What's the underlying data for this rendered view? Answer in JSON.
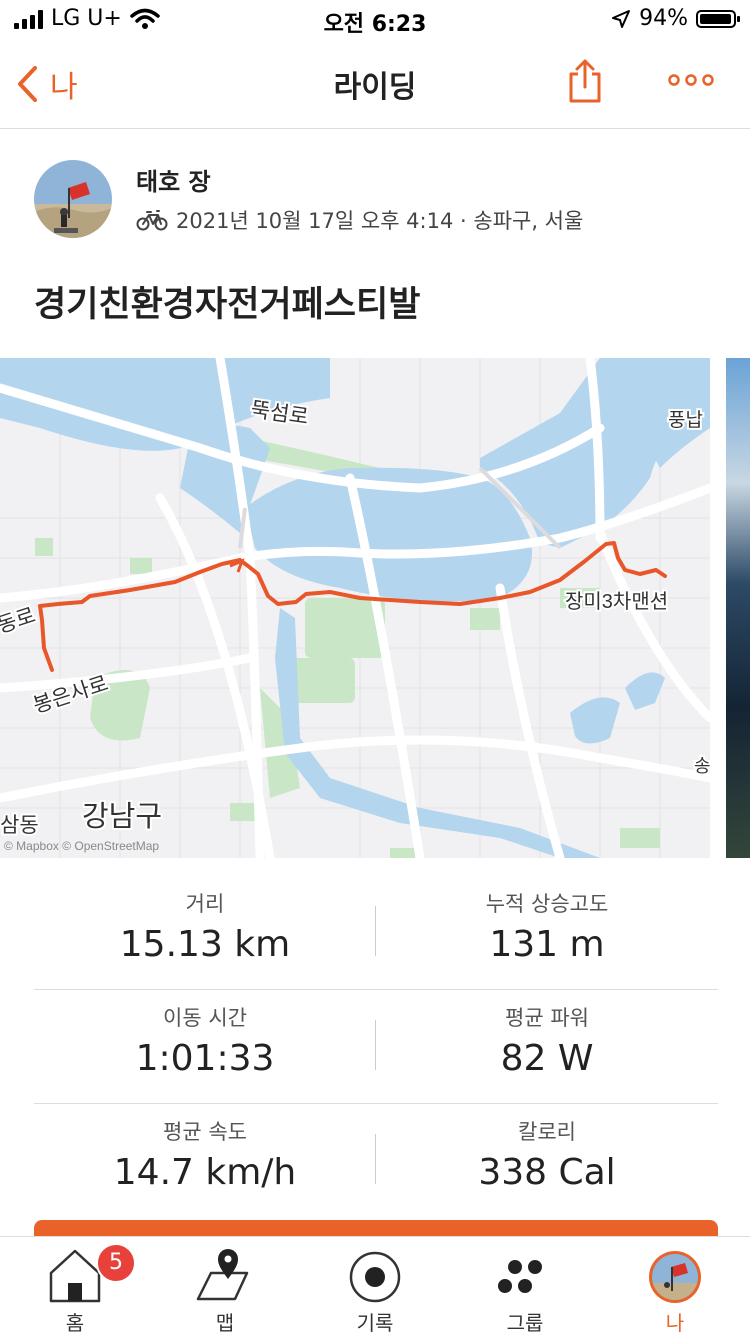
{
  "status_bar": {
    "carrier": "LG U+",
    "time": "오전 6:23",
    "battery": "94%"
  },
  "nav": {
    "back_label": "나",
    "title": "라이딩"
  },
  "activity": {
    "athlete": "태호 장",
    "meta": "2021년 10월 17일 오후 4:14 · 송파구, 서울",
    "title": "경기친환경자전거페스티발"
  },
  "map": {
    "labels": {
      "ttukseom": "뚝섬로",
      "pungnap": "풍납",
      "jangmi": "장미3차맨션",
      "dongro": "동로",
      "bongeun": "봉은사로",
      "gangnam": "강남구",
      "samdong": "삼동",
      "song": "송",
      "attribution": "© Mapbox © OpenStreetMap"
    }
  },
  "stats": [
    {
      "left": {
        "label": "거리",
        "value": "15.13 km"
      },
      "right": {
        "label": "누적 상승고도",
        "value": "131 m"
      }
    },
    {
      "left": {
        "label": "이동 시간",
        "value": "1:01:33"
      },
      "right": {
        "label": "평균 파워",
        "value": "82 W"
      }
    },
    {
      "left": {
        "label": "평균 속도",
        "value": "14.7 km/h"
      },
      "right": {
        "label": "칼로리",
        "value": "338 Cal"
      }
    }
  ],
  "tabs": [
    {
      "label": "홈",
      "icon": "home-icon",
      "badge": "5"
    },
    {
      "label": "맵",
      "icon": "map-icon"
    },
    {
      "label": "기록",
      "icon": "record-icon"
    },
    {
      "label": "그룹",
      "icon": "groups-icon"
    },
    {
      "label": "나",
      "icon": "profile-avatar",
      "active": true
    }
  ],
  "colors": {
    "accent": "#e8622a",
    "badge": "#e8403a",
    "water": "#b3d5ee",
    "park": "#c9e6c6"
  }
}
